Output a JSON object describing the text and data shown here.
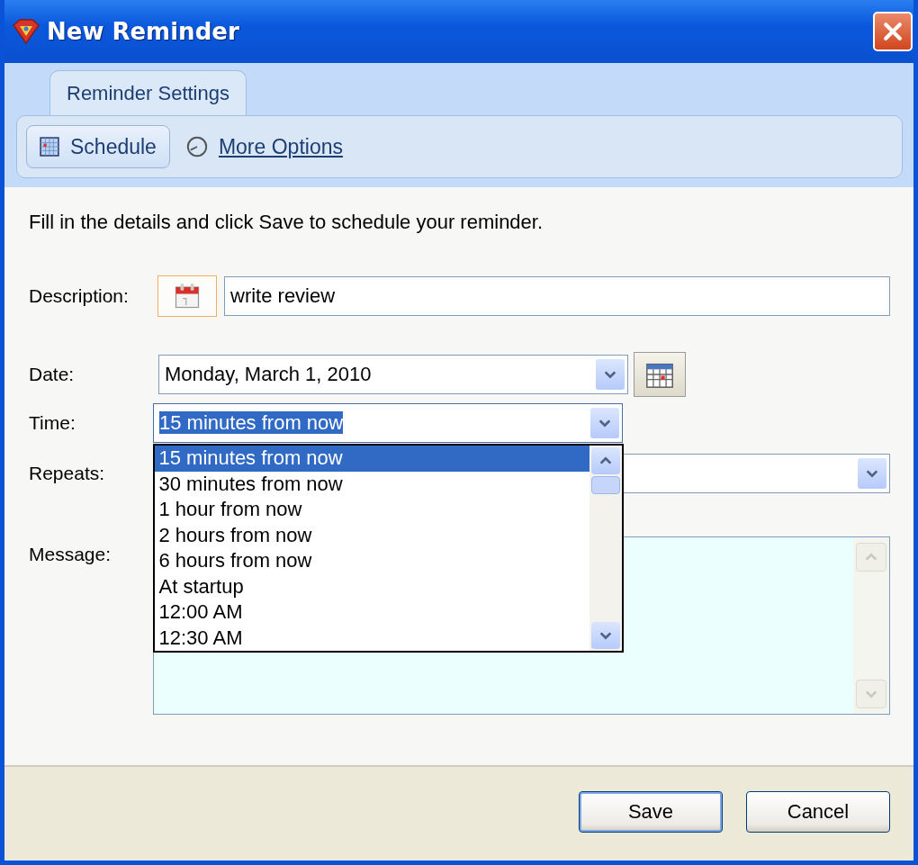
{
  "window": {
    "title": "New Reminder"
  },
  "tabs": [
    {
      "label": "Reminder Settings",
      "selected": true
    }
  ],
  "toolbar": [
    {
      "label": "Schedule",
      "kind": "button",
      "selected": true
    },
    {
      "label": "More Options",
      "kind": "link",
      "selected": false
    }
  ],
  "instructions": "Fill in the details and click Save to schedule your reminder.",
  "form": {
    "description": {
      "label": "Description:",
      "value": "write review"
    },
    "date": {
      "label": "Date:",
      "value": "Monday, March 1, 2010"
    },
    "time": {
      "label": "Time:",
      "value": "15 minutes from now",
      "expanded": true,
      "options": [
        {
          "label": "15 minutes from now",
          "selected": true
        },
        {
          "label": "30 minutes from now",
          "selected": false
        },
        {
          "label": "1 hour from now",
          "selected": false
        },
        {
          "label": "2 hours from now",
          "selected": false
        },
        {
          "label": "6 hours from now",
          "selected": false
        },
        {
          "label": "At startup",
          "selected": false
        },
        {
          "label": "12:00 AM",
          "selected": false
        },
        {
          "label": "12:30 AM",
          "selected": false
        }
      ]
    },
    "repeats": {
      "label": "Repeats:"
    },
    "message": {
      "label": "Message:"
    }
  },
  "buttons": [
    {
      "label": "Save",
      "default": true
    },
    {
      "label": "Cancel",
      "default": false
    }
  ]
}
